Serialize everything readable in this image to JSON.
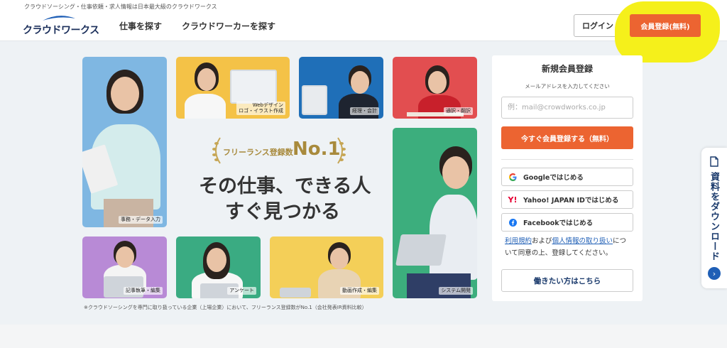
{
  "header": {
    "tagline": "クラウドソーシング・仕事依頼・求人情報は日本最大級のクラウドワークス",
    "logo_text": "クラウドワークス",
    "nav": [
      "仕事を探す",
      "クラウドワーカーを探す"
    ],
    "login_label": "ログイン",
    "register_label": "会員登録(無料)"
  },
  "tiles": {
    "data_entry": "事務・データ入力",
    "web_design": "Webデザイン\nロゴ・イラスト作成",
    "accounting": "経理・会計",
    "translation": "通訳・翻訳",
    "system_dev": "システム開発",
    "writing": "記事執筆・編集",
    "survey": "アンケート",
    "video": "動画作成・編集"
  },
  "hero": {
    "badge_text": "フリーランス登録数",
    "badge_rank": "No.1",
    "headline_1": "その仕事、できる人",
    "headline_2": "すぐ見つかる",
    "footnote": "※クラウドソーシングを専門に取り扱っている企業（上場企業）において、フリーランス登録数がNo.1（会社発表IR資料比較）"
  },
  "signup": {
    "title": "新規会員登録",
    "subtitle": "メールアドレスを入力してください",
    "email_placeholder": "例：mail@crowdworks.co.jp",
    "cta": "今すぐ会員登録する（無料）",
    "google": "Googleではじめる",
    "yahoo": "Yahoo! JAPAN IDではじめる",
    "facebook": "Facebookではじめる",
    "terms_link": "利用規約",
    "and": "および",
    "privacy_link": "個人情報の取り扱い",
    "terms_rest": "について同意の上、登録してください。",
    "worker_button": "働きたい方はこちら"
  },
  "side_tab": {
    "label": "資料をダウンロード"
  },
  "colors": {
    "accent": "#ec6431",
    "brand": "#1a3a6c",
    "highlight": "#f5f01b",
    "link": "#1f5fb6"
  }
}
